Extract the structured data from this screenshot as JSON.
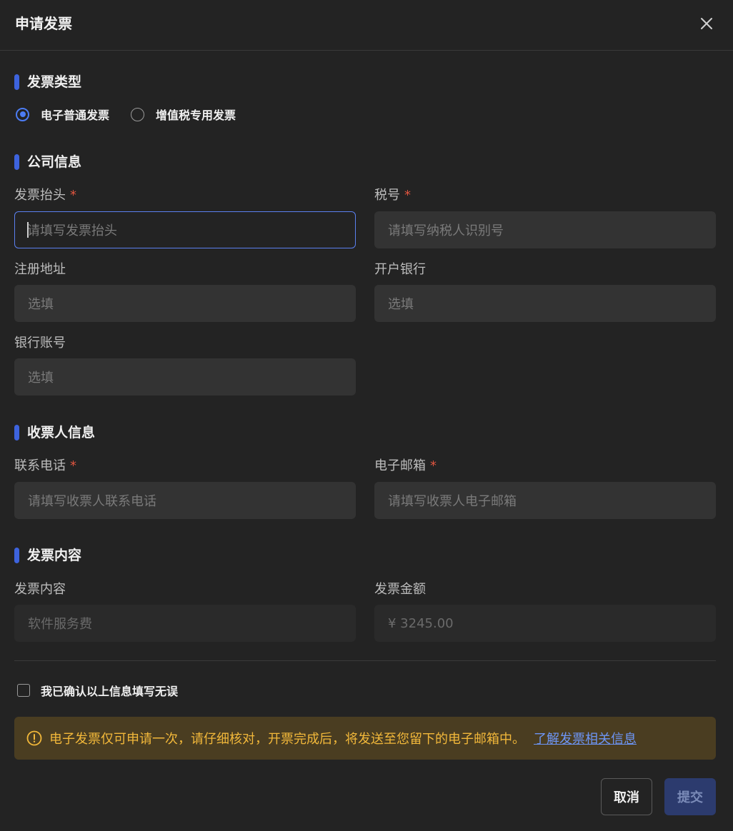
{
  "dialog": {
    "title": "申请发票"
  },
  "sections": {
    "invoice_type": "发票类型",
    "company_info": "公司信息",
    "recipient_info": "收票人信息",
    "invoice_content": "发票内容"
  },
  "invoice_type": {
    "options": [
      "电子普通发票",
      "增值税专用发票"
    ],
    "selected": "电子普通发票"
  },
  "company": {
    "title_label": "发票抬头",
    "title_placeholder": "请填写发票抬头",
    "tax_label": "税号",
    "tax_placeholder": "请填写纳税人识别号",
    "address_label": "注册地址",
    "address_placeholder": "选填",
    "bank_label": "开户银行",
    "bank_placeholder": "选填",
    "account_label": "银行账号",
    "account_placeholder": "选填"
  },
  "recipient": {
    "phone_label": "联系电话",
    "phone_placeholder": "请填写收票人联系电话",
    "email_label": "电子邮箱",
    "email_placeholder": "请填写收票人电子邮箱"
  },
  "content": {
    "content_label": "发票内容",
    "content_value": "软件服务费",
    "amount_label": "发票金额",
    "amount_value": "¥ 3245.00"
  },
  "required_mark": "*",
  "confirm": {
    "label": "我已确认以上信息填写无误",
    "checked": false
  },
  "notice": {
    "text": "电子发票仅可申请一次，请仔细核对，开票完成后，将发送至您留下的电子邮箱中。",
    "link": "了解发票相关信息",
    "icon": "warning-circle-icon",
    "color": "#f2b83a",
    "background": "#4a3d21"
  },
  "buttons": {
    "cancel": "取消",
    "submit": "提交"
  },
  "colors": {
    "accent": "#3d63dd",
    "required": "#e1553f",
    "link": "#6d95f5"
  }
}
